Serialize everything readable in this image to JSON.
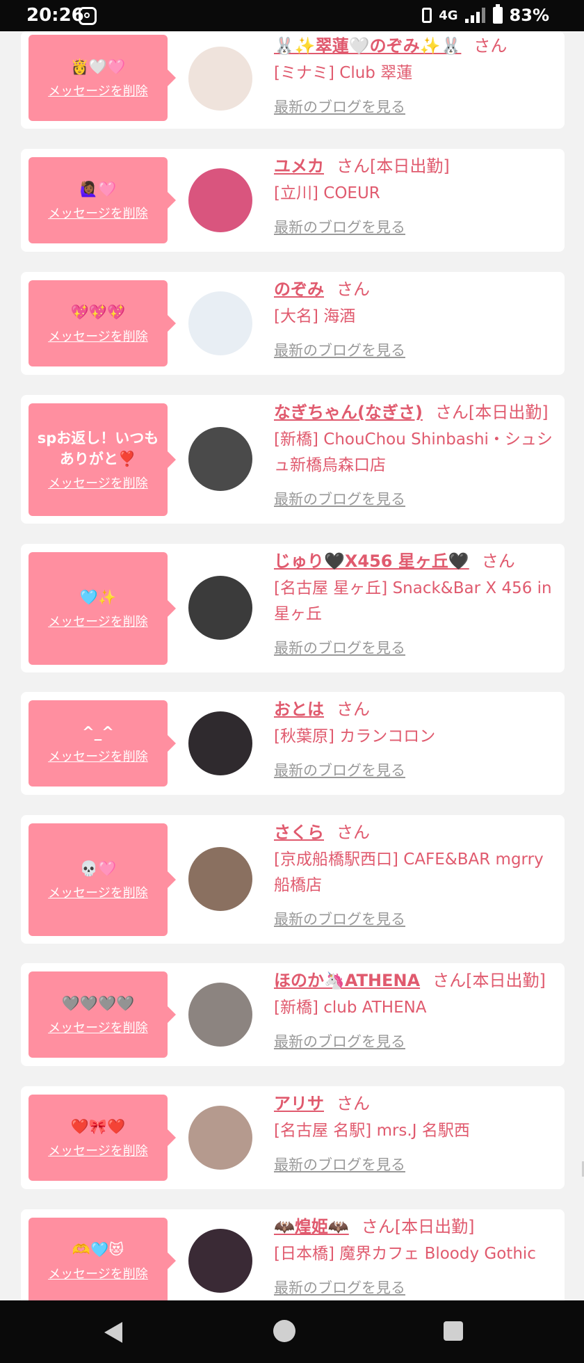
{
  "status_bar": {
    "time": "20:26",
    "network": "4G",
    "battery": "83%"
  },
  "delete_label": "メッセージを削除",
  "blog_label": "最新のブログを見る",
  "entries": [
    {
      "message": "👸🤍🩷",
      "name": "🐰✨翠蓮🤍のぞみ✨🐰",
      "suffix": "さん",
      "shop": "[ミナミ] Club 翠蓮",
      "avatar_color": "#efe3dc"
    },
    {
      "message": "🙋🏾‍♀️🩷",
      "name": "ユメカ",
      "suffix": "さん[本日出勤]",
      "shop": "[立川] COEUR",
      "avatar_color": "#d9557e"
    },
    {
      "message": "💖💖💖",
      "name": "のぞみ",
      "suffix": "さん",
      "shop": "[大名] 海酒",
      "avatar_color": "#e8eef4"
    },
    {
      "message": "spお返し！いつもありがと❣️",
      "name": "なぎちゃん(なぎさ)",
      "suffix": "さん[本日出勤]",
      "shop": "[新橋] ChouChou Shinbashi・シュシュ新橋烏森口店",
      "avatar_color": "#4a4a4a"
    },
    {
      "message": "🩵✨",
      "name": "じゅり🖤X456 星ヶ丘🖤",
      "suffix": "さん",
      "shop": "[名古屋 星ヶ丘] Snack&Bar X 456 in 星ヶ丘",
      "avatar_color": "#3b3b3b"
    },
    {
      "message": "^_^",
      "name": "おとは",
      "suffix": "さん",
      "shop": "[秋葉原] カランコロン",
      "avatar_color": "#2f2a2e"
    },
    {
      "message": "💀🩷",
      "name": "さくら",
      "suffix": "さん",
      "shop": "[京成船橋駅西口] CAFE&BAR mgrry 船橋店",
      "avatar_color": "#8a7060"
    },
    {
      "message": "🩶🩶🩶🩶",
      "name": "ほのか🦄ATHENA",
      "suffix": "さん[本日出勤]",
      "shop": "[新橋] club ATHENA",
      "avatar_color": "#8c8480"
    },
    {
      "message": "❤️🎀❤️",
      "name": "アリサ",
      "suffix": "さん",
      "shop": "[名古屋 名駅] mrs.J 名駅西",
      "avatar_color": "#b59a8e"
    },
    {
      "message": "🫶🩵😻",
      "name": "🦇煌姫🦇",
      "suffix": "さん[本日出勤]",
      "shop": "[日本橋] 魔界カフェ Bloody Gothic",
      "avatar_color": "#3a2a35"
    }
  ]
}
